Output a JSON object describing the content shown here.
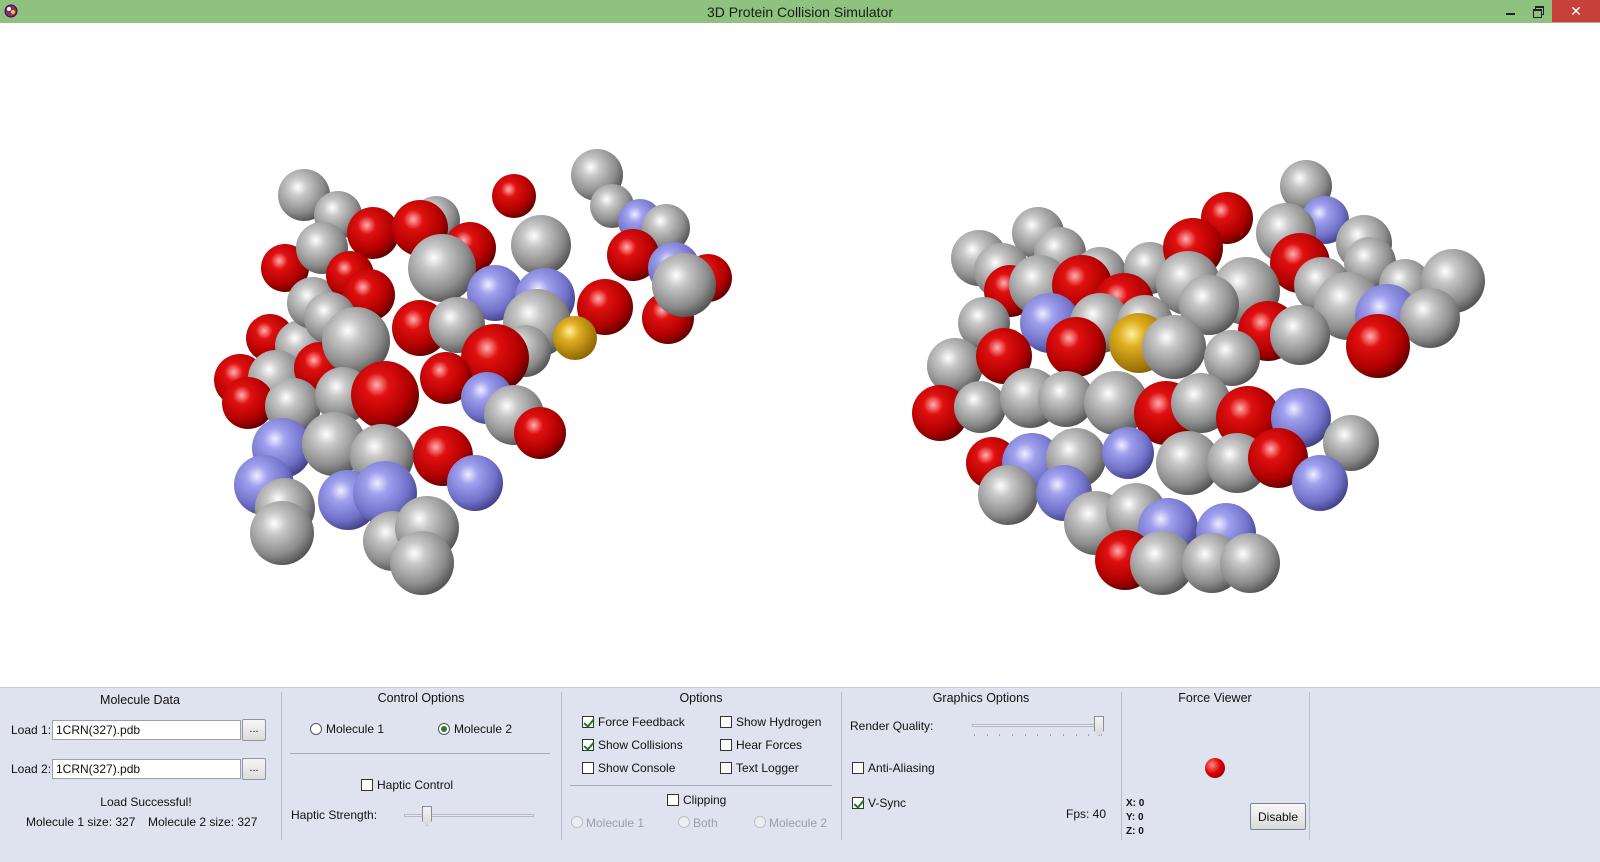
{
  "window": {
    "title": "3D Protein Collision Simulator",
    "icon": "molecule-app-icon",
    "controls": [
      "minimize-icon",
      "restore-icon",
      "close-icon"
    ],
    "accent_color": "#8fc27f"
  },
  "viewport": {
    "background": "#ffffff",
    "atom_colors": {
      "carbon": "#8c8c8c",
      "oxygen": "#cc0000",
      "nitrogen": "#7f7fd6",
      "sulfur": "#d4a000"
    }
  },
  "molecule_data": {
    "title": "Molecule Data",
    "load1_label": "Load 1:",
    "load1_value": "1CRN(327).pdb",
    "load2_label": "Load 2:",
    "load2_value": "1CRN(327).pdb",
    "browse_label": "...",
    "status": "Load Successful!",
    "size1": "Molecule 1 size: 327",
    "size2": "Molecule 2 size: 327"
  },
  "control_options": {
    "title": "Control Options",
    "radio_molecule1": "Molecule 1",
    "radio_molecule2": "Molecule 2",
    "selected": "Molecule 2",
    "haptic_control": "Haptic Control",
    "haptic_control_checked": false,
    "haptic_strength_label": "Haptic Strength:",
    "haptic_strength_level": 0.15
  },
  "options": {
    "title": "Options",
    "force_feedback": "Force Feedback",
    "force_feedback_checked": true,
    "show_collisions": "Show Collisions",
    "show_collisions_checked": true,
    "show_console": "Show Console",
    "show_console_checked": false,
    "show_hydrogen": "Show Hydrogen",
    "show_hydrogen_checked": false,
    "hear_forces": "Hear Forces",
    "hear_forces_checked": false,
    "text_logger": "Text Logger",
    "text_logger_checked": false,
    "clipping": "Clipping",
    "clipping_checked": false,
    "clip_molecule1": "Molecule 1",
    "clip_both": "Both",
    "clip_molecule2": "Molecule 2"
  },
  "graphics_options": {
    "title": "Graphics Options",
    "render_quality_label": "Render Quality:",
    "render_quality_level": 1.0,
    "anti_aliasing": "Anti-Aliasing",
    "anti_aliasing_checked": false,
    "vsync": "V-Sync",
    "vsync_checked": true,
    "fps": "Fps: 40"
  },
  "force_viewer": {
    "title": "Force Viewer",
    "x": "X: 0",
    "y": "Y: 0",
    "z": "Z: 0",
    "disable_label": "Disable"
  }
}
